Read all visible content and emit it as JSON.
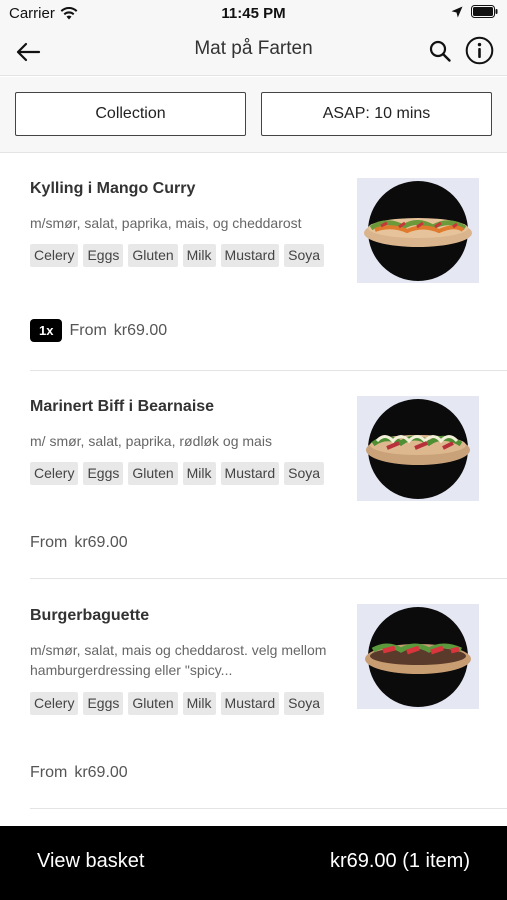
{
  "status_bar": {
    "carrier": "Carrier",
    "time": "11:45 PM"
  },
  "nav": {
    "title": "Mat på Farten",
    "back_icon": "arrow-left-icon",
    "search_icon": "search-icon",
    "info_icon": "info-icon"
  },
  "options": {
    "collection": "Collection",
    "asap": "ASAP: 10 mins"
  },
  "items": [
    {
      "name": "Kylling i Mango Curry",
      "description": "m/smør, salat, paprika, mais, og cheddarost",
      "allergens": [
        "Celery",
        "Eggs",
        "Gluten",
        "Milk",
        "Mustard",
        "Soya"
      ],
      "quantity": "1x",
      "from_label": "From",
      "price": "kr69.00"
    },
    {
      "name": "Marinert Biff i Bearnaise",
      "description": "m/ smør, salat, paprika, rødløk og mais",
      "allergens": [
        "Celery",
        "Eggs",
        "Gluten",
        "Milk",
        "Mustard",
        "Soya"
      ],
      "from_label": "From",
      "price": "kr69.00"
    },
    {
      "name": "Burgerbaguette",
      "description": "m/smør, salat, mais og cheddarost. velg mellom hamburgerdressing eller \"spicy...",
      "allergens": [
        "Celery",
        "Eggs",
        "Gluten",
        "Milk",
        "Mustard",
        "Soya"
      ],
      "from_label": "From",
      "price": "kr69.00"
    }
  ],
  "basket": {
    "label": "View basket",
    "total": "kr69.00 (1 item)"
  },
  "colors": {
    "header_bg": "#f7f7f7",
    "basket_bg": "#000000",
    "tag_bg": "#e8e8e8",
    "thumb_bg": "#e5e7f3"
  }
}
